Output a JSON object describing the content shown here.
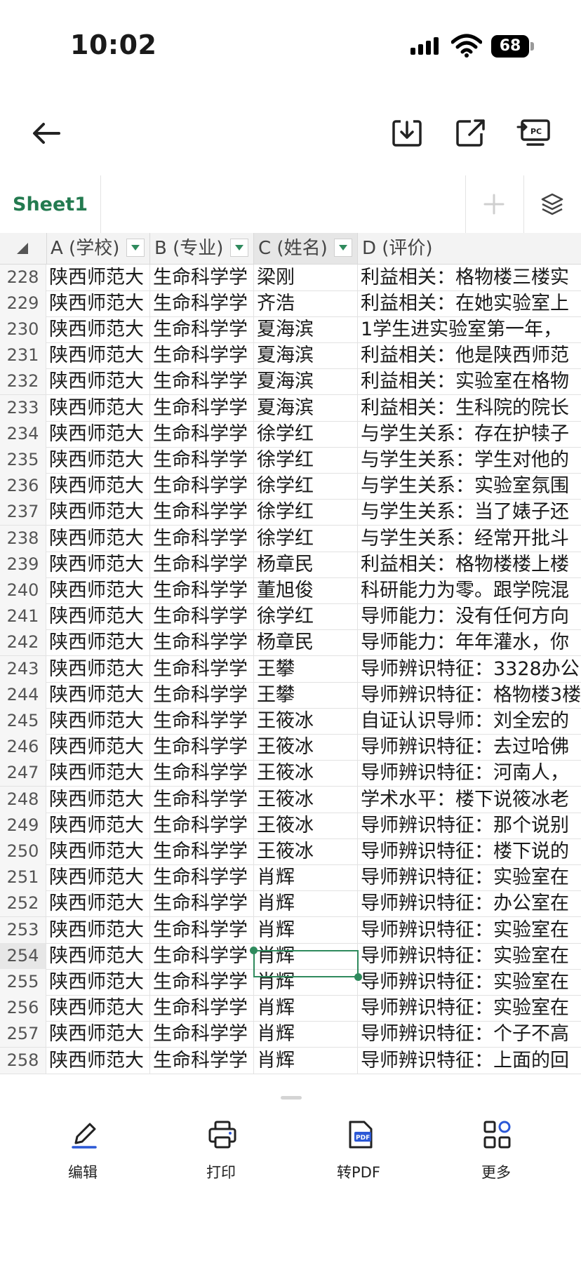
{
  "status_bar": {
    "time": "10:02",
    "battery": "68"
  },
  "sheet_tabs": {
    "active": "Sheet1"
  },
  "columns": [
    {
      "label": "A (学校)"
    },
    {
      "label": "B (专业)"
    },
    {
      "label": "C (姓名)"
    },
    {
      "label": "D (评价)"
    }
  ],
  "rows": [
    {
      "n": "228",
      "a": "陕西师范大",
      "b": "生命科学学",
      "c": "梁刚",
      "d": "利益相关：格物楼三楼实"
    },
    {
      "n": "229",
      "a": "陕西师范大",
      "b": "生命科学学",
      "c": "齐浩",
      "d": "利益相关：在她实验室上"
    },
    {
      "n": "230",
      "a": "陕西师范大",
      "b": "生命科学学",
      "c": "夏海滨",
      "d": "1学生进实验室第一年，"
    },
    {
      "n": "231",
      "a": "陕西师范大",
      "b": "生命科学学",
      "c": "夏海滨",
      "d": "利益相关：他是陕西师范"
    },
    {
      "n": "232",
      "a": "陕西师范大",
      "b": "生命科学学",
      "c": "夏海滨",
      "d": "利益相关：实验室在格物"
    },
    {
      "n": "233",
      "a": "陕西师范大",
      "b": "生命科学学",
      "c": "夏海滨",
      "d": "利益相关：生科院的院长"
    },
    {
      "n": "234",
      "a": "陕西师范大",
      "b": "生命科学学",
      "c": "徐学红",
      "d": "与学生关系：存在护犊子"
    },
    {
      "n": "235",
      "a": "陕西师范大",
      "b": "生命科学学",
      "c": "徐学红",
      "d": "与学生关系：学生对他的"
    },
    {
      "n": "236",
      "a": "陕西师范大",
      "b": "生命科学学",
      "c": "徐学红",
      "d": "与学生关系：实验室氛围"
    },
    {
      "n": "237",
      "a": "陕西师范大",
      "b": "生命科学学",
      "c": "徐学红",
      "d": "与学生关系：当了婊子还"
    },
    {
      "n": "238",
      "a": "陕西师范大",
      "b": "生命科学学",
      "c": "徐学红",
      "d": "与学生关系：经常开批斗"
    },
    {
      "n": "239",
      "a": "陕西师范大",
      "b": "生命科学学",
      "c": "杨章民",
      "d": "利益相关：格物楼楼上楼"
    },
    {
      "n": "240",
      "a": "陕西师范大",
      "b": "生命科学学",
      "c": "董旭俊",
      "d": "科研能力为零。跟学院混"
    },
    {
      "n": "241",
      "a": "陕西师范大",
      "b": "生命科学学",
      "c": "徐学红",
      "d": "导师能力：没有任何方向"
    },
    {
      "n": "242",
      "a": "陕西师范大",
      "b": "生命科学学",
      "c": "杨章民",
      "d": "导师能力：年年灌水，你"
    },
    {
      "n": "243",
      "a": "陕西师范大",
      "b": "生命科学学",
      "c": "王攀",
      "d": "导师辨识特征：3328办公"
    },
    {
      "n": "244",
      "a": "陕西师范大",
      "b": "生命科学学",
      "c": "王攀",
      "d": "导师辨识特征：格物楼3楼"
    },
    {
      "n": "245",
      "a": "陕西师范大",
      "b": "生命科学学",
      "c": "王筱冰",
      "d": "自证认识导师：刘全宏的"
    },
    {
      "n": "246",
      "a": "陕西师范大",
      "b": "生命科学学",
      "c": "王筱冰",
      "d": "导师辨识特征：去过哈佛"
    },
    {
      "n": "247",
      "a": "陕西师范大",
      "b": "生命科学学",
      "c": "王筱冰",
      "d": "导师辨识特征：河南人，"
    },
    {
      "n": "248",
      "a": "陕西师范大",
      "b": "生命科学学",
      "c": "王筱冰",
      "d": "学术水平：楼下说筱冰老"
    },
    {
      "n": "249",
      "a": "陕西师范大",
      "b": "生命科学学",
      "c": "王筱冰",
      "d": "导师辨识特征：那个说别"
    },
    {
      "n": "250",
      "a": "陕西师范大",
      "b": "生命科学学",
      "c": "王筱冰",
      "d": "导师辨识特征：楼下说的"
    },
    {
      "n": "251",
      "a": "陕西师范大",
      "b": "生命科学学",
      "c": "肖辉",
      "d": "导师辨识特征：实验室在"
    },
    {
      "n": "252",
      "a": "陕西师范大",
      "b": "生命科学学",
      "c": "肖辉",
      "d": "导师辨识特征：办公室在"
    },
    {
      "n": "253",
      "a": "陕西师范大",
      "b": "生命科学学",
      "c": "肖辉",
      "d": "导师辨识特征：实验室在"
    },
    {
      "n": "254",
      "a": "陕西师范大",
      "b": "生命科学学",
      "c": "肖辉",
      "d": "导师辨识特征：实验室在"
    },
    {
      "n": "255",
      "a": "陕西师范大",
      "b": "生命科学学",
      "c": "肖辉",
      "d": "导师辨识特征：实验室在"
    },
    {
      "n": "256",
      "a": "陕西师范大",
      "b": "生命科学学",
      "c": "肖辉",
      "d": "导师辨识特征：实验室在"
    },
    {
      "n": "257",
      "a": "陕西师范大",
      "b": "生命科学学",
      "c": "肖辉",
      "d": "导师辨识特征：个子不高"
    },
    {
      "n": "258",
      "a": "陕西师范大",
      "b": "生命科学学",
      "c": "肖辉",
      "d": "导师辨识特征：上面的回"
    }
  ],
  "selected_row": "254",
  "toolbar": {
    "edit": "编辑",
    "print": "打印",
    "to_pdf": "转PDF",
    "more": "更多"
  },
  "icons": {
    "back": "arrow-left-icon",
    "download": "download-icon",
    "share": "share-icon",
    "pc": "pc-screen-icon",
    "add_sheet": "plus-icon",
    "layers": "layers-icon"
  },
  "colors": {
    "accent": "#237a4f",
    "selection": "#2f8a5d"
  }
}
